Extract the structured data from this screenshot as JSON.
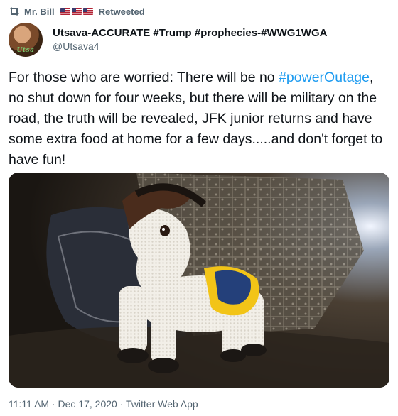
{
  "retweet": {
    "icon": "retweet-icon",
    "user_name": "Mr. Bill",
    "flag_count": 3,
    "label": "Retweeted"
  },
  "author": {
    "display_name": "Utsava-ACCURATE #Trump #prophecies-#WWG1WGA",
    "handle": "@Utsava4",
    "avatar_text": "Utsa"
  },
  "tweet": {
    "text_part1": "For those who are worried: There will be no ",
    "hashtag": "#powerOutage",
    "text_part2": ", no shut down for four weeks, but there will be military on the road, the truth will be revealed, JFK junior returns and have some extra food at home for a few days.....and don't forget to have fun!"
  },
  "media": {
    "alt": "Crocheted donkey toy"
  },
  "meta": {
    "time": "11:11 AM",
    "date": "Dec 17, 2020",
    "source": "Twitter Web App",
    "separator": " · "
  },
  "colors": {
    "accent": "#1d9bf0",
    "secondary_text": "#536471",
    "primary_text": "#0f1419"
  }
}
